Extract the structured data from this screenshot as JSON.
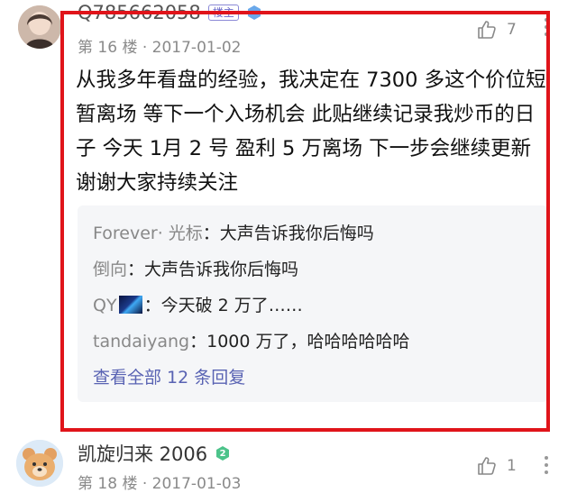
{
  "comments": [
    {
      "username": "Q785662058",
      "owner_badge": "楼主",
      "floor": "第 16 楼",
      "date": "2017-01-02",
      "likes": "7",
      "body": "从我多年看盘的经验，我决定在 7300 多这个价位短暂离场 等下一个入场机会 此贴继续记录我炒币的日子 今天 1月 2 号 盈利 5 万离场 下一步会继续更新 谢谢大家持续关注",
      "replies": [
        {
          "user": "Forever· 光标",
          "text": "：大声告诉我你后悔吗"
        },
        {
          "user": "倒向",
          "text": "：大声告诉我你后悔吗"
        },
        {
          "user": "QY",
          "text": "：今天破 2 万了……"
        },
        {
          "user": "tandaiyang",
          "text": "：1000 万了，哈哈哈哈哈哈"
        }
      ],
      "view_all_label": "查看全部 12 条回复"
    },
    {
      "username": "凯旋归来 2006",
      "level": "2",
      "floor": "第 18 楼",
      "date": "2017-01-03",
      "likes": "1"
    }
  ],
  "colors": {
    "highlight": "#e0141a",
    "link": "#5963b3",
    "badge": "#6a67c7"
  }
}
